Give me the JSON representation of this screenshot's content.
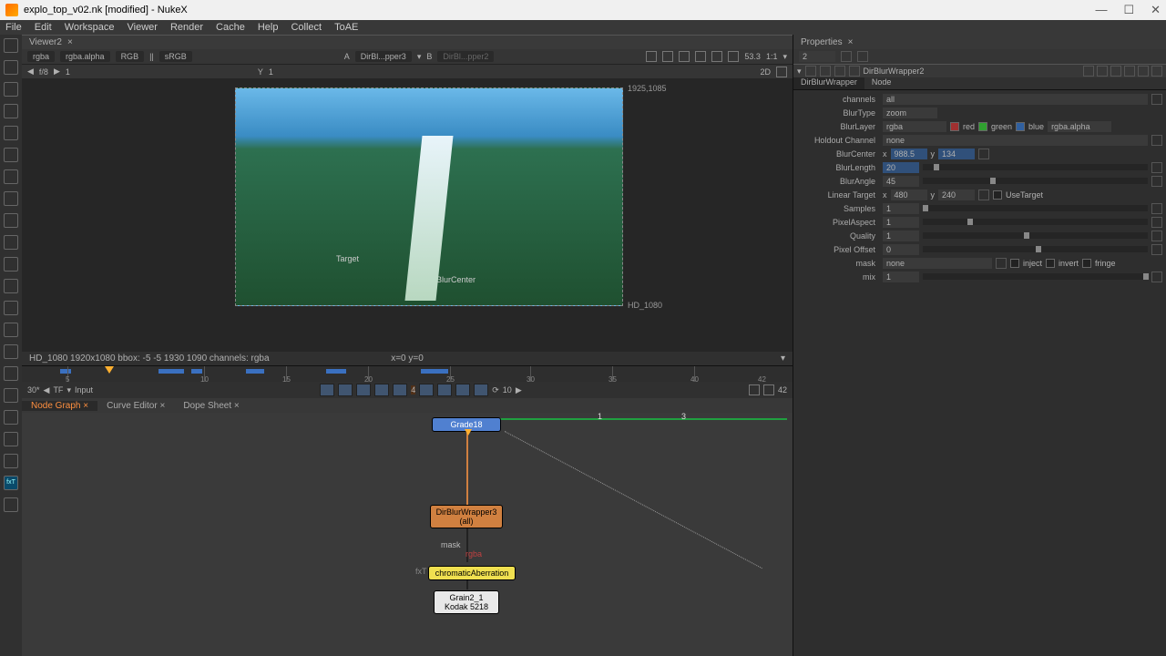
{
  "title": "explo_top_v02.nk [modified] - NukeX",
  "menus": [
    "File",
    "Edit",
    "Workspace",
    "Viewer",
    "Render",
    "Cache",
    "Help",
    "Collect",
    "ToAE"
  ],
  "viewer": {
    "tab": "Viewer2",
    "channels": "rgba",
    "alpha": "rgba.alpha",
    "colorspace": "RGB",
    "lut": "sRGB",
    "inputA": "A",
    "inputA_node": "DirBl...pper3",
    "inputB": "B",
    "inputB_node": "DirBl...pper2",
    "zoom": "53.3",
    "ratio": "1:1",
    "fstop": "f/8",
    "gamma": "1",
    "y_label": "Y",
    "y_val": "1",
    "dim_mode": "2D",
    "readout_tr": "1925,1085",
    "readout_br": "HD_1080",
    "target_label": "Target",
    "center_label": "BlurCenter"
  },
  "infobar": {
    "format": "HD_1080 1920x1080  bbox:  -5 -5 1930 1090 channels: rgba",
    "coords": "x=0 y=0"
  },
  "timeline": {
    "start": "30*",
    "tf": "TF",
    "input": "Input",
    "loop": "10",
    "frame": "42",
    "play_frame": "4",
    "ticks": [
      "5",
      "10",
      "15",
      "20",
      "25",
      "30",
      "35",
      "40",
      "42"
    ]
  },
  "graph_tabs": [
    "Node Graph",
    "Curve Editor",
    "Dope Sheet"
  ],
  "nodes": {
    "grade": "Grade18",
    "dirblur": "DirBlurWrapper3",
    "dirblur_ch": "(all)",
    "chroma": "chromaticAberration",
    "chroma_prefix": "fxT",
    "grain": "Grain2_1",
    "grain_sub": "Kodak 5218",
    "mask": "mask",
    "rgba": "rgba",
    "handle1": "1",
    "handle2": "3"
  },
  "props": {
    "panel": "Properties",
    "count": "2",
    "node": "DirBlurWrapper2",
    "tab1": "DirBlurWrapper",
    "tab2": "Node",
    "channels_lbl": "channels",
    "channels_val": "all",
    "blurtype_lbl": "BlurType",
    "blurtype_val": "zoom",
    "blurlayer_lbl": "BlurLayer",
    "blurlayer_val": "rgba",
    "red": "red",
    "green": "green",
    "blue": "blue",
    "rgba_alpha": "rgba.alpha",
    "holdout_lbl": "Holdout Channel",
    "holdout_val": "none",
    "center_lbl": "BlurCenter",
    "center_x_lbl": "x",
    "center_x": "988.5",
    "center_y_lbl": "y",
    "center_y": "134",
    "length_lbl": "BlurLength",
    "length_val": "20",
    "angle_lbl": "BlurAngle",
    "angle_val": "45",
    "linear_lbl": "Linear Target",
    "linear_x_lbl": "x",
    "linear_x": "480",
    "linear_y_lbl": "y",
    "linear_y": "240",
    "usetarget": "UseTarget",
    "samples_lbl": "Samples",
    "samples_val": "1",
    "pixelaspect_lbl": "PixelAspect",
    "pixelaspect_val": "1",
    "quality_lbl": "Quality",
    "quality_val": "1",
    "pixeloffset_lbl": "Pixel Offset",
    "pixeloffset_val": "0",
    "mask_lbl": "mask",
    "mask_val": "none",
    "inject": "inject",
    "invert": "invert",
    "fringe": "fringe",
    "mix_lbl": "mix",
    "mix_val": "1"
  }
}
